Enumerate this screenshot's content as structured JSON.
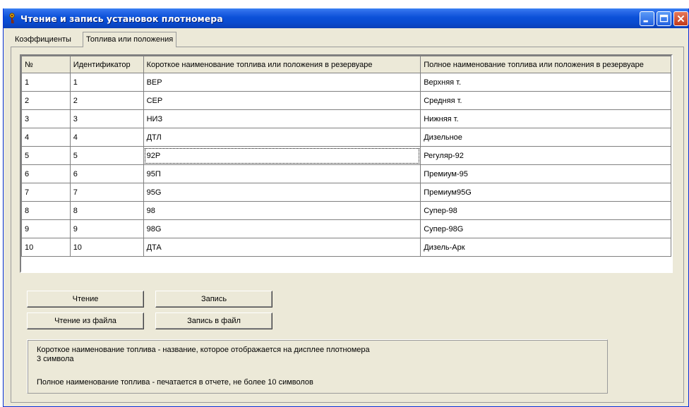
{
  "window": {
    "title": "Чтение и запись установок плотномера"
  },
  "tabs": [
    {
      "label": "Коэффициенты",
      "active": false
    },
    {
      "label": "Топлива или положения",
      "active": true
    }
  ],
  "grid": {
    "columns": [
      "№",
      "Идентификатор",
      "Короткое наименование топлива или положения в резервуаре",
      "Полное наименование топлива или положения в резервуаре"
    ],
    "rows": [
      [
        "1",
        "1",
        "ВЕР",
        "Верхняя т."
      ],
      [
        "2",
        "2",
        "СЕР",
        "Средняя т."
      ],
      [
        "3",
        "3",
        "НИЗ",
        "Нижняя т."
      ],
      [
        "4",
        "4",
        "ДТЛ",
        "Дизельное"
      ],
      [
        "5",
        "5",
        "92Р",
        "Регуляр-92"
      ],
      [
        "6",
        "6",
        "95П",
        "Премиум-95"
      ],
      [
        "7",
        "7",
        "95G",
        "Премиум95G"
      ],
      [
        "8",
        "8",
        "98",
        "Супер-98"
      ],
      [
        "9",
        "9",
        "98G",
        "Супер-98G"
      ],
      [
        "10",
        "10",
        "ДТА",
        "Дизель-Арк"
      ]
    ],
    "focused_cell": {
      "row": 4,
      "col": 2
    }
  },
  "buttons": {
    "read": "Чтение",
    "write": "Запись",
    "read_file": "Чтение из файла",
    "write_file": "Запись в файл"
  },
  "info": {
    "line1": "Короткое наименование топлива - название, которое отображается на дисплее плотномера",
    "line2": "3 символа",
    "line3": "Полное наименование топлива - печатается в отчете, не более 10 символов"
  },
  "colors": {
    "titlebar": "#0a4cd0",
    "window_bg": "#ece9d8",
    "close_button": "#c1391a"
  },
  "icons": {
    "app": "key-icon",
    "minimize": "minimize-icon",
    "maximize": "maximize-icon",
    "close": "close-icon"
  }
}
